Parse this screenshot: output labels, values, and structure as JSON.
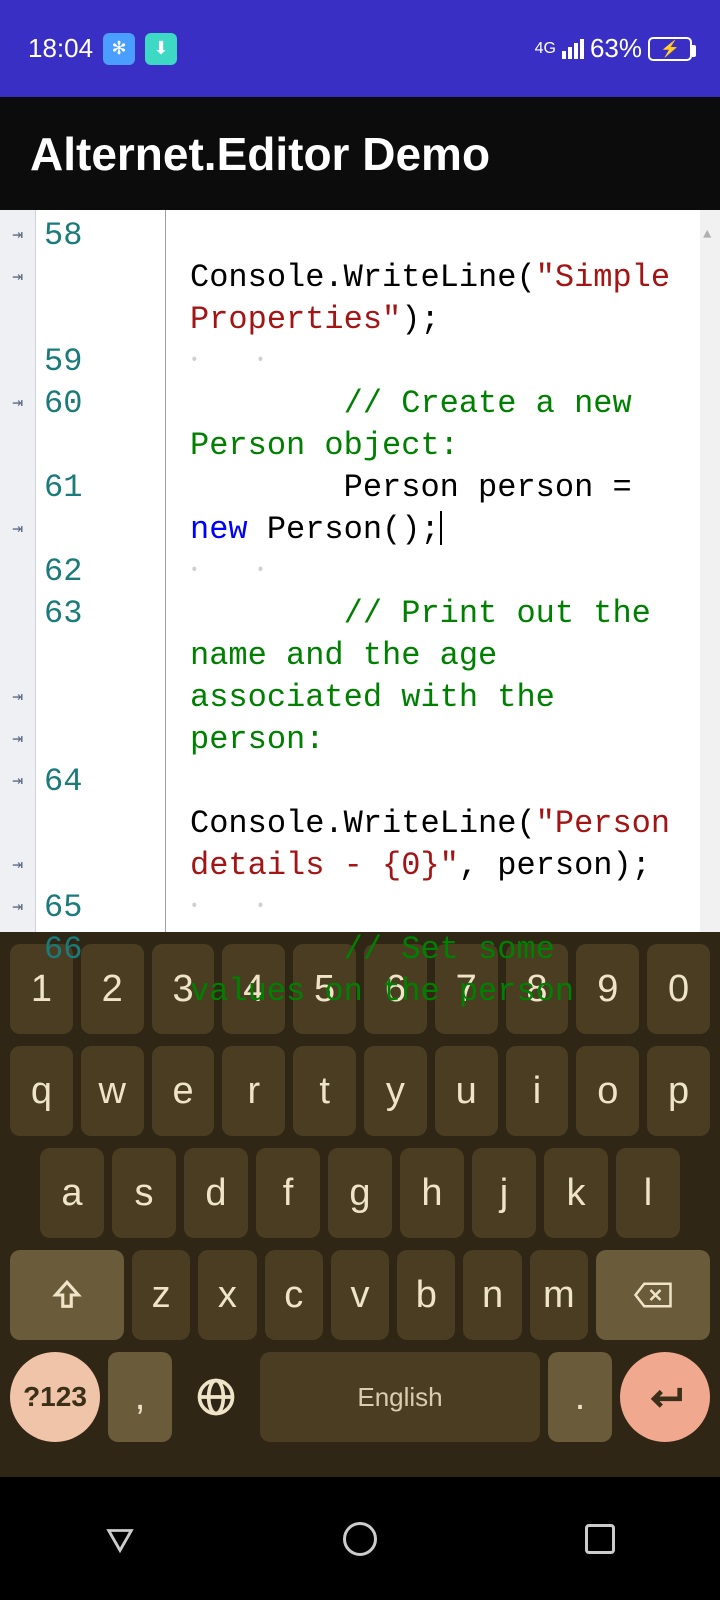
{
  "status": {
    "time": "18:04",
    "network": "4G",
    "battery": "63%",
    "battery_icon": "⚡"
  },
  "app": {
    "title": "Alternet.Editor Demo"
  },
  "editor": {
    "lines": [
      {
        "n": "58",
        "html": "        Console.WriteLine(<span class='tk-str'>\"Simple Properties\"</span>);"
      },
      {
        "n": "59",
        "html": "<span class='indent-guide'>⸱   ⸱</span>"
      },
      {
        "n": "60",
        "html": "        <span class='tk-com'>// Create a new Person object:</span>"
      },
      {
        "n": "61",
        "html": "        Person person = <span class='tk-kw'>new</span> Person();<span class='caret'></span>"
      },
      {
        "n": "62",
        "html": "<span class='indent-guide'>⸱   ⸱</span>"
      },
      {
        "n": "63",
        "html": "        <span class='tk-com'>// Print out the name and the age associated with the person:</span>"
      },
      {
        "n": "64",
        "html": "        Console.WriteLine(<span class='tk-str'>\"Person details - {0}\"</span>, person);"
      },
      {
        "n": "65",
        "html": "<span class='indent-guide'>⸱   ⸱</span>"
      },
      {
        "n": "66",
        "html": "        <span class='tk-com'>// Set some values on the person</span>"
      }
    ],
    "fold_rows_with_mark": [
      0,
      1,
      4,
      7,
      11,
      12,
      13,
      15,
      16,
      18
    ]
  },
  "keyboard": {
    "row1": [
      "1",
      "2",
      "3",
      "4",
      "5",
      "6",
      "7",
      "8",
      "9",
      "0"
    ],
    "row2": [
      "q",
      "w",
      "e",
      "r",
      "t",
      "y",
      "u",
      "i",
      "o",
      "p"
    ],
    "row3": [
      "a",
      "s",
      "d",
      "f",
      "g",
      "h",
      "j",
      "k",
      "l"
    ],
    "row4": [
      "z",
      "x",
      "c",
      "v",
      "b",
      "n",
      "m"
    ],
    "shift": "⇧",
    "backspace": "⌫",
    "sym": "?123",
    "comma": ",",
    "globe": "🌐",
    "space": "English",
    "dot": ".",
    "enter": "↵"
  }
}
